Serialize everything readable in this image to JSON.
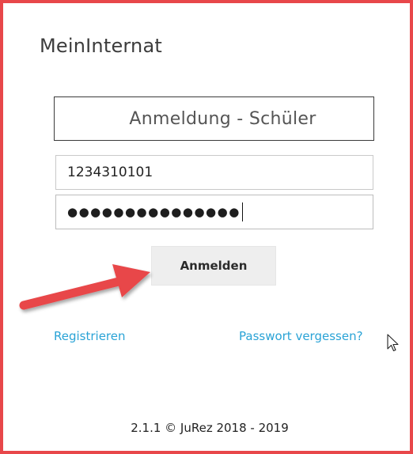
{
  "app": {
    "title": "MeinInternat"
  },
  "login": {
    "mode_label": "Anmeldung - Schüler",
    "username_value": "1234310101",
    "password_masked": "●●●●●●●●●●●●●●●",
    "submit_label": "Anmelden"
  },
  "links": {
    "register": "Registrieren",
    "forgot_password": "Passwort vergessen?"
  },
  "footer": {
    "version_text": "2.1.1 © JuRez 2018 - 2019"
  },
  "colors": {
    "annotation_red": "#e8474a",
    "link_blue": "#2aa3d6",
    "button_gray": "#eeeeee"
  },
  "icons": {
    "annotation": "arrow-annotation-icon",
    "pointer": "mouse-cursor-icon"
  }
}
